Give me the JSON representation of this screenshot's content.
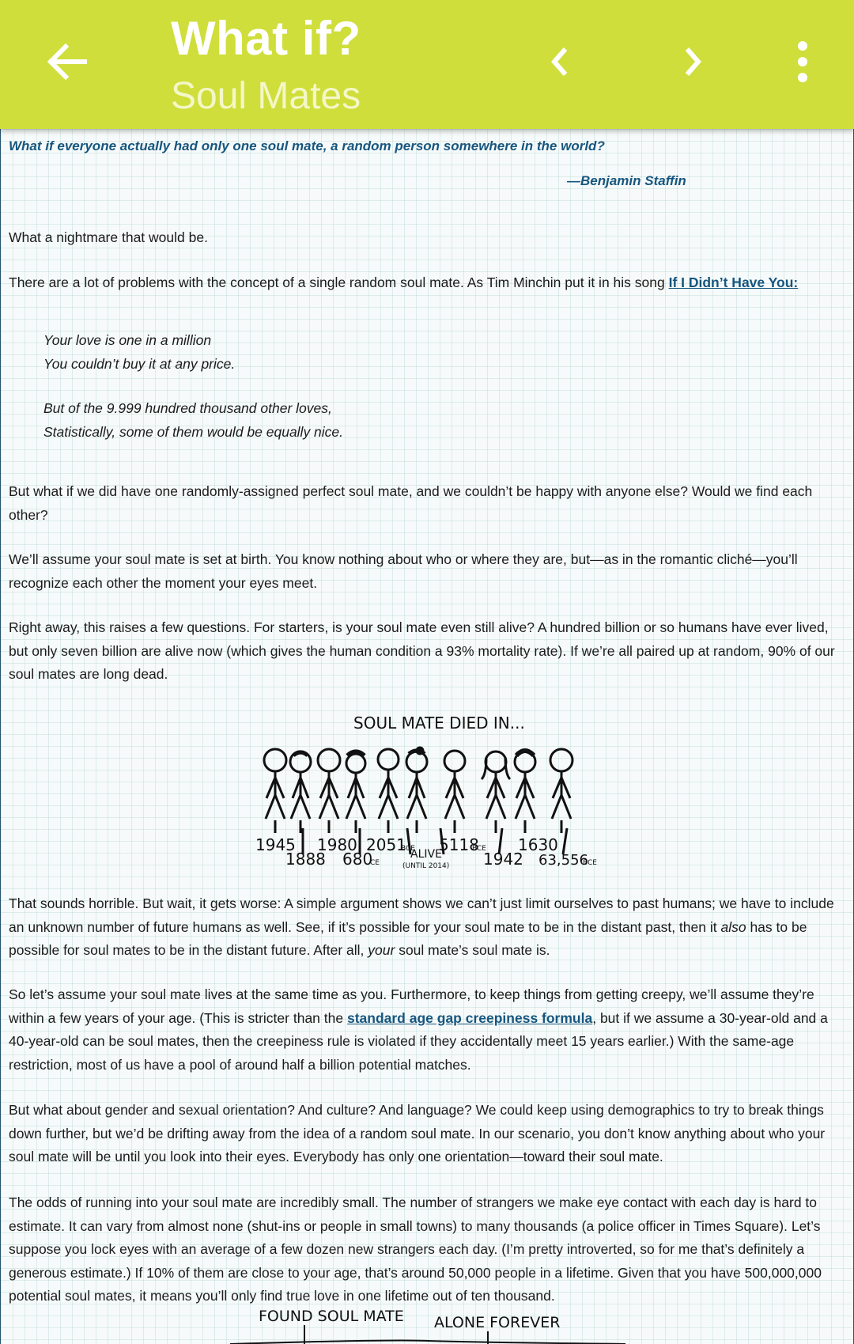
{
  "header": {
    "title": "What if?",
    "subtitle": "Soul Mates",
    "back_icon": "arrow-left-icon",
    "prev_icon": "chevron-left-icon",
    "next_icon": "chevron-right-icon",
    "menu_icon": "more-vertical-icon",
    "color": "#cfde3b"
  },
  "article": {
    "question": "What if everyone actually had only one soul mate, a random person somewhere in the world?",
    "attribution": "—Benjamin Staffin",
    "p1": "What a nightmare that would be.",
    "p2_text": "There are a lot of problems with the concept of a single random soul mate. As Tim Minchin put it in his song ",
    "p2_link": "If I Didn’t Have You:",
    "quote": [
      "Your love is one in a million",
      "You couldn’t buy it at any price.",
      "But of the 9.999 hundred thousand other loves,",
      "Statistically, some of them would be equally nice."
    ],
    "p3": "But what if we did have one randomly-assigned perfect soul mate, and we couldn’t be happy with anyone else? Would we find each other?",
    "p4": "We’ll assume your soul mate is set at birth. You know nothing about who or where they are, but—as in the romantic cliché—you’ll recognize each other the moment your eyes meet.",
    "p5": "Right away, this raises a few questions. For starters, is your soul mate even still alive? A hundred billion or so humans have ever lived, but only seven billion are alive now (which gives the human condition a 93% mortality rate). If we’re all paired up at random, 90% of our soul mates are long dead.",
    "comic1": {
      "caption": "SOUL MATE DIED IN...",
      "labels_top": [
        "1945",
        "1980",
        "2051",
        "BCE",
        "5118",
        "BCE",
        "1630"
      ],
      "labels_bottom": [
        "1888",
        "680",
        "CE",
        "ALIVE",
        "(UNTIL 2014)",
        "1942",
        "63,556",
        "BCE"
      ]
    },
    "p6_a": "That sounds horrible. But wait, it gets worse: A simple argument shows we can’t just limit ourselves to past humans; we have to include an unknown number of future humans as well. See, if it’s possible for your soul mate to be in the distant past, then it ",
    "p6_em1": "also",
    "p6_b": " has to be possible for soul mates to be in the distant future. After all, ",
    "p6_em2": "your",
    "p6_c": " soul mate’s soul mate is.",
    "p7_a": "So let’s assume your soul mate lives at the same time as you. Furthermore, to keep things from getting creepy, we’ll assume they’re within a few years of your age. (This is stricter than the ",
    "p7_link": "standard age gap creepiness formula",
    "p7_b": ", but if we assume a 30-year-old and a 40-year-old can be soul mates, then the creepiness rule is violated if they accidentally meet 15 years earlier.) With the same-age restriction, most of us have a pool of around half a billion potential matches.",
    "p8": "But what about gender and sexual orientation? And culture? And language? We could keep using demographics to try to break things down further, but we’d be drifting away from the idea of a random soul mate. In our scenario, you don’t know anything about who your soul mate will be until you look into their eyes. Everybody has only one orientation—toward their soul mate.",
    "p9": "The odds of running into your soul mate are incredibly small. The number of strangers we make eye contact with each day is hard to estimate. It can vary from almost none (shut-ins or people in small towns) to many thousands (a police officer in Times Square). Let’s suppose you lock eyes with an average of a few dozen new strangers each day. (I’m pretty introverted, so for me that’s definitely a generous estimate.) If 10% of them are close to your age, that’s around 50,000 people in a lifetime. Given that you have 500,000,000 potential soul mates, it means you’ll only find true love in one lifetime out of ten thousand.",
    "comic2": {
      "label_left": "FOUND SOUL MATE",
      "label_right": "ALONE FOREVER"
    }
  }
}
